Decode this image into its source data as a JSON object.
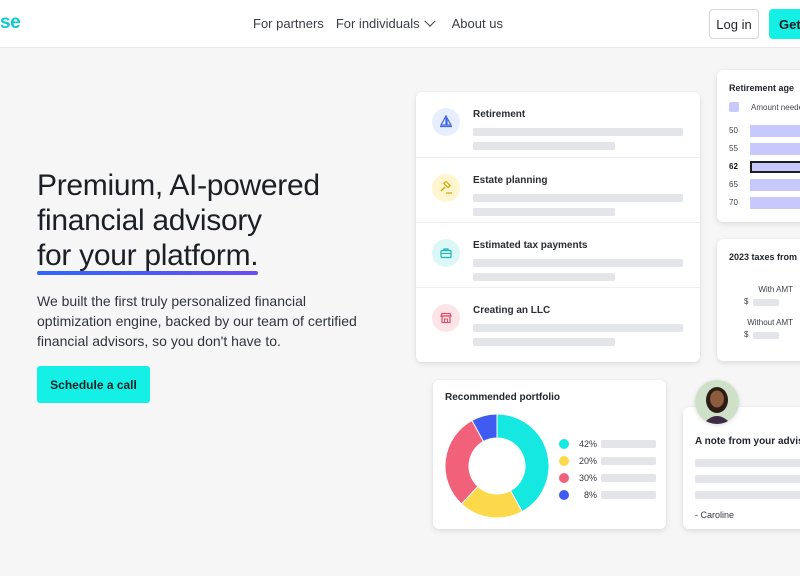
{
  "brand": {
    "logo_text": "se",
    "accent": "#15f0e6"
  },
  "nav": {
    "items": [
      {
        "label": "For partners"
      },
      {
        "label": "For individuals",
        "has_dropdown": true
      },
      {
        "label": "About us"
      }
    ],
    "login_label": "Log in",
    "get_label": "Get"
  },
  "hero": {
    "title_line1": "Premium, AI-powered",
    "title_line2": "financial advisory",
    "title_line3": "for your platform.",
    "description": "We built the first truly personalized financial optimization engine, backed by our team of certified financial advisors, so you don't have to.",
    "cta_label": "Schedule a call"
  },
  "topics": [
    {
      "label": "Retirement",
      "icon": "sailboat-icon"
    },
    {
      "label": "Estate planning",
      "icon": "gavel-icon"
    },
    {
      "label": "Estimated tax payments",
      "icon": "briefcase-icon"
    },
    {
      "label": "Creating an LLC",
      "icon": "storefront-icon"
    }
  ],
  "retirement_card": {
    "title": "Retirement age",
    "legend": "Amount needed",
    "ages": [
      "50",
      "55",
      "62",
      "65",
      "70"
    ],
    "selected_age": "62"
  },
  "tax_card": {
    "title": "2023 taxes from",
    "rows": [
      {
        "label": "With AMT",
        "currency": "$"
      },
      {
        "label": "Without AMT",
        "currency": "$"
      }
    ]
  },
  "portfolio": {
    "title": "Recommended portfolio",
    "slices": [
      {
        "pct": "42%",
        "value": 42,
        "color": "#15e8e0"
      },
      {
        "pct": "20%",
        "value": 20,
        "color": "#fcd94a"
      },
      {
        "pct": "30%",
        "value": 30,
        "color": "#f2617a"
      },
      {
        "pct": "8%",
        "value": 8,
        "color": "#3f5bf2"
      }
    ]
  },
  "note": {
    "title": "A note from your advisor",
    "signature": "- Caroline"
  }
}
